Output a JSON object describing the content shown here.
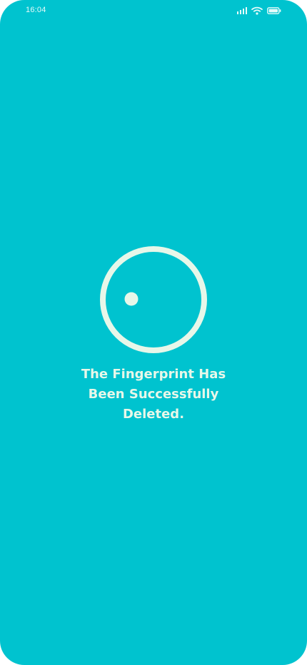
{
  "status_bar": {
    "time": "16:04",
    "icons": [
      "cellular-signal-icon",
      "wifi-icon",
      "battery-icon"
    ]
  },
  "main": {
    "indicator_icon": "circle-with-dot-icon",
    "message_lines": [
      "The Fingerprint Has",
      "Been Successfully",
      "Deleted."
    ]
  },
  "colors": {
    "background": "#00C3CF",
    "accent": "#E7F7E9"
  }
}
